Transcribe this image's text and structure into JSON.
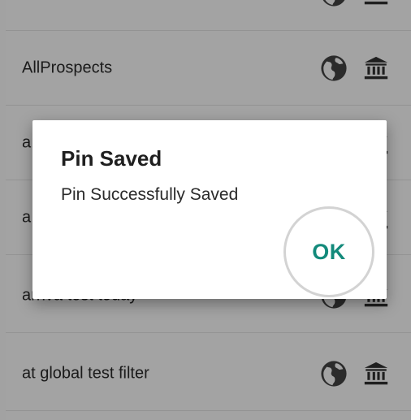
{
  "list": {
    "items": [
      {
        "label": ""
      },
      {
        "label": "AllProspects"
      },
      {
        "label": "a"
      },
      {
        "label": "a"
      },
      {
        "label": "arriva test today"
      },
      {
        "label": "at global test filter"
      }
    ]
  },
  "icons": {
    "globe": "globe-icon",
    "bank": "bank-icon"
  },
  "dialog": {
    "title": "Pin Saved",
    "message": "Pin Successfully Saved",
    "ok_label": "OK"
  },
  "colors": {
    "accent": "#138a7b",
    "scrim_row": "#a3a3a3"
  }
}
